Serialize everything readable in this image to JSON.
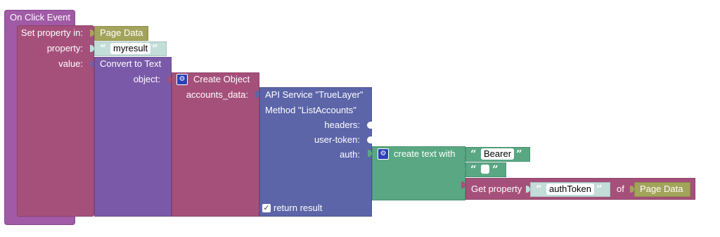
{
  "event": {
    "title": "On Click Event"
  },
  "set_property": {
    "label_in": "Set property in:",
    "target": "Page Data",
    "label_property": "property:",
    "property_value": "myresult",
    "label_value": "value:"
  },
  "convert": {
    "title": "Convert to Text",
    "label_object": "object:"
  },
  "create_object": {
    "title": "Create Object",
    "label_accounts": "accounts_data:"
  },
  "api_service": {
    "title": "API Service \"TrueLayer\"",
    "method": "Method \"ListAccounts\"",
    "label_headers": "headers:",
    "label_user_token": "user-token:",
    "label_auth": "auth:",
    "return_label": "return result",
    "return_checked": true
  },
  "create_text": {
    "title": "create text with",
    "part1": "Bearer",
    "part2": " "
  },
  "get_property": {
    "title": "Get property",
    "property_value": "authToken",
    "label_of": "of",
    "target": "Page Data"
  },
  "icons": {
    "gear": "gear-icon",
    "quote_open": "“",
    "quote_close": "”",
    "checkbox": "✓"
  },
  "colors": {
    "event": "#a05aa6",
    "set_property": "#a5507a",
    "convert": "#7a5aa8",
    "api": "#5c65a8",
    "text": "#5aa883",
    "page_data": "#a3a45b"
  }
}
